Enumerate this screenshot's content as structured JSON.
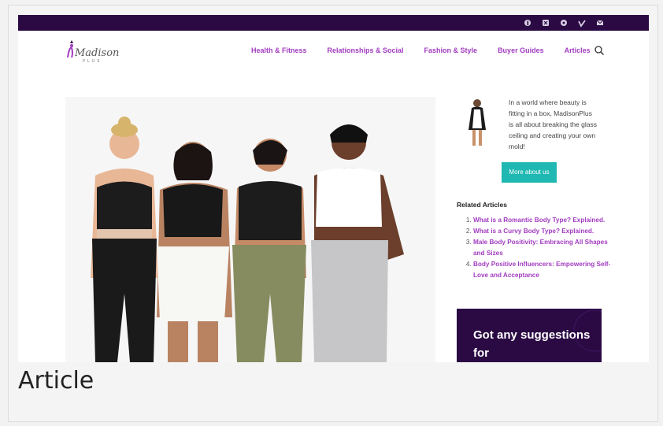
{
  "topbar": {
    "social_icons": [
      "facebook-icon",
      "x-twitter-icon",
      "pinterest-icon",
      "vimeo-icon",
      "email-icon"
    ],
    "background": "#2b0a44"
  },
  "header": {
    "logo_text": "Madison",
    "logo_subtext": "PLUS",
    "nav": [
      {
        "label": "Health & Fitness"
      },
      {
        "label": "Relationships & Social"
      },
      {
        "label": "Fashion & Style"
      },
      {
        "label": "Buyer Guides"
      },
      {
        "label": "Articles"
      }
    ],
    "accent": "#a23cc0"
  },
  "sidebar": {
    "about_text": "In a world where beauty is fitting in a box, MadisonPlus is all about breaking the glass ceiling and creating your own mold!",
    "about_button": "More about us",
    "button_color": "#20b8b2",
    "related_title": "Related Articles",
    "related": [
      {
        "label": "What is a Romantic Body Type? Explained."
      },
      {
        "label": "What is a Curvy Body Type? Explained."
      },
      {
        "label": "Male Body Positivity: Embracing All Shapes and Sizes"
      },
      {
        "label": "Body Positive Influencers: Empowering Self-Love and Acceptance"
      }
    ],
    "cta_text": "Got any suggestions for"
  },
  "caption": "Article"
}
